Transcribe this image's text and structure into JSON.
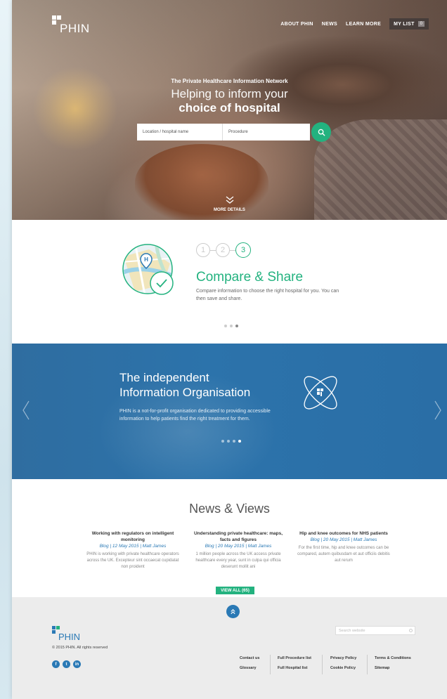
{
  "header": {
    "logo_text": "PHIN",
    "nav": [
      "ABOUT PHIN",
      "NEWS",
      "LEARN MORE"
    ],
    "my_list_label": "MY LIST",
    "my_list_count": "0"
  },
  "hero": {
    "eyebrow": "The Private Healthcare Information Network",
    "title_line1": "Helping to inform your",
    "title_line2": "choice of hospital",
    "location_placeholder": "Location / hospital name",
    "procedure_placeholder": "Procedure",
    "more_details": "MORE DETAILS"
  },
  "steps": {
    "numbers": [
      "1",
      "2",
      "3"
    ],
    "active_step": 3,
    "title": "Compare & Share",
    "description": "Compare information to choose the right hospital for you. You can then save and share.",
    "carousel_count": 3,
    "carousel_active": 3
  },
  "feature": {
    "title_line1": "The independent",
    "title_line2": "Information Organisation",
    "description": "PHIN is a not-for-profit organisation dedicated to providing accessible information to help patients find the right treatment for them.",
    "carousel_count": 4,
    "carousel_active": 4
  },
  "news": {
    "title": "News & Views",
    "articles": [
      {
        "title": "Working with regulators on intelligent monitoring",
        "meta": "Blog | 12 May 2015 | Matt James",
        "excerpt": "PHIN is working with private healthcare operators across the UK. Excepteur sint occaecat cupidatat non proident"
      },
      {
        "title": "Understanding private healthcare: maps, facts and figures",
        "meta": "Blog | 20 May 2015 | Matt James",
        "excerpt": "1 million people across the UK access private healthcare every year, sunt in culpa qui officia deserunt mollit ani"
      },
      {
        "title": "Hip and knee outcomes for NHS patients",
        "meta": "Blog | 20 May 2015 | Matt James",
        "excerpt": "For the first time, hip and knee outcomes can be compared, autem quibusdam et aut officiis debitis aut rerum"
      }
    ],
    "view_all": "VIEW ALL (65)"
  },
  "footer": {
    "logo_text": "PHIN",
    "copyright": "© 2015 PHIN. All rights reserved",
    "search_placeholder": "Search website",
    "social": [
      "f",
      "t",
      "in"
    ],
    "link_columns": [
      [
        "Contact us",
        "Glossary"
      ],
      [
        "Full Procedure list",
        "Full Hospital list"
      ],
      [
        "Privacy Policy",
        "Cookie Policy"
      ],
      [
        "Terms & Conditions",
        "Sitemap"
      ]
    ]
  },
  "colors": {
    "accent_green": "#23b27f",
    "brand_blue": "#2a79b5",
    "band_blue": "#2c73ab"
  }
}
